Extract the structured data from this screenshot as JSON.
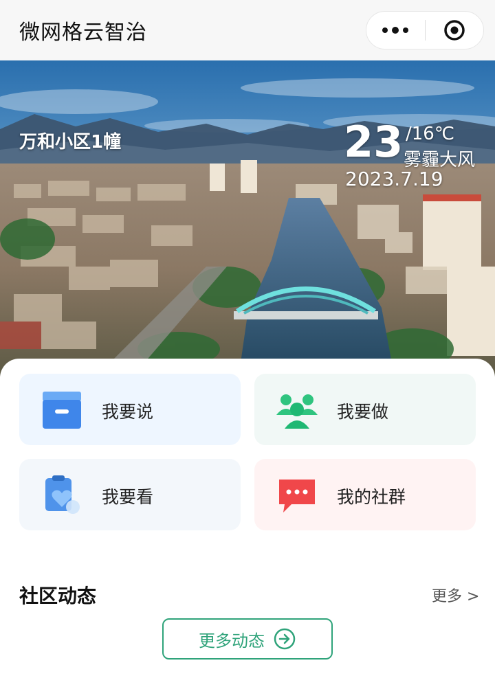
{
  "header": {
    "title": "微网格云智治",
    "menu_icon": "more-dots-icon",
    "close_icon": "target-icon"
  },
  "hero": {
    "community": "万和小区1幢",
    "temperature": "23",
    "temp_low": "/16℃",
    "weather": "雾霾大风",
    "date": "2023.7.19"
  },
  "actions": [
    {
      "label": "我要说",
      "icon": "inbox-icon",
      "color": "#4a90f0"
    },
    {
      "label": "我要做",
      "icon": "group-icon",
      "color": "#25c07a"
    },
    {
      "label": "我要看",
      "icon": "clipboard-heart-icon",
      "color": "#5aa8f0"
    },
    {
      "label": "我的社群",
      "icon": "chat-bubble-icon",
      "color": "#f04a4a"
    }
  ],
  "section": {
    "title": "社区动态",
    "more_link": "更多 >",
    "more_button": "更多动态",
    "accent": "#2fa37a"
  }
}
